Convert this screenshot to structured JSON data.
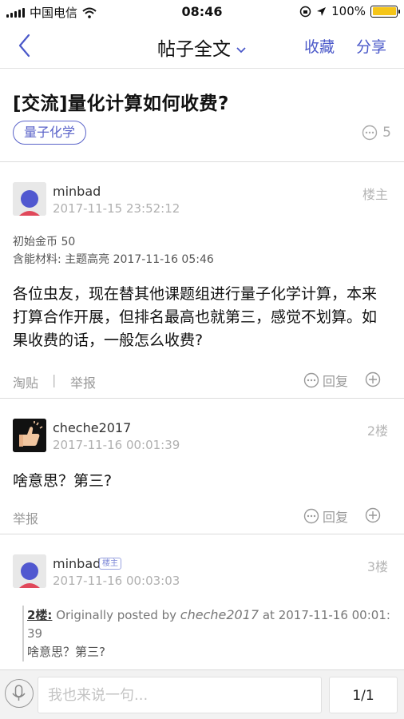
{
  "status_bar": {
    "carrier": "中国电信",
    "time": "08:46",
    "battery": "100%",
    "battery_level": 1.0
  },
  "nav": {
    "title": "帖子全文",
    "favorite": "收藏",
    "share": "分享"
  },
  "post": {
    "title": "[交流]量化计算如何收费?",
    "tag": "量子化学",
    "reply_count": "5"
  },
  "posts": [
    {
      "username": "minbad",
      "timestamp": "2017-11-15 23:52:12",
      "floor": "楼主",
      "meta_coins": "初始金币 50",
      "meta_material": "含能材料: 主题高亮 2017-11-16 05:46",
      "content": "各位虫友，现在替其他课题组进行量子化学计算，本来打算合作开展，但排名最高也就第三，感觉不划算。如果收费的话，一般怎么收费?",
      "actions": {
        "tao": "淘贴",
        "divider": "|",
        "report": "举报",
        "reply": "回复"
      }
    },
    {
      "username": "cheche2017",
      "timestamp": "2017-11-16 00:01:39",
      "floor": "2楼",
      "content": "啥意思？第三?",
      "actions": {
        "report": "举报",
        "reply": "回复"
      }
    },
    {
      "username": "minbad",
      "owner_badge": "楼主",
      "timestamp": "2017-11-16 00:03:03",
      "floor": "3楼",
      "quote": {
        "floor_ref": "2楼:",
        "prefix": " Originally posted by ",
        "author": "cheche2017",
        "suffix": " at 2017-11-16 00:01:",
        "suffix2": "39",
        "text": "啥意思？第三?"
      }
    }
  ],
  "bottom": {
    "input_placeholder": "我也来说一句...",
    "page": "1/1"
  },
  "colors": {
    "accent": "#4a58c9",
    "avatar_head": "#5158d0",
    "avatar_body": "#e0485a",
    "battery": "#f5c518"
  }
}
